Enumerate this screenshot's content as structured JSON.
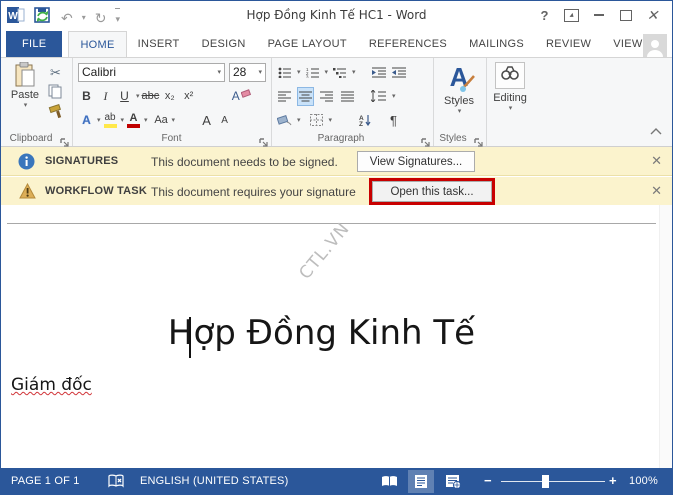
{
  "window": {
    "title": "Hợp Đồng Kinh Tế HC1 - Word",
    "controls": {
      "help": "?"
    }
  },
  "icons": {
    "dropdown": "▾",
    "undo": "↶",
    "redo": "↻",
    "scissors": "✂",
    "close": "✕",
    "info": "i",
    "warning": "!"
  },
  "tabs": {
    "file_label": "FILE",
    "items": [
      "HOME",
      "INSERT",
      "DESIGN",
      "PAGE LAYOUT",
      "REFERENCES",
      "MAILINGS",
      "REVIEW",
      "VIEW"
    ],
    "active": "HOME"
  },
  "ribbon": {
    "clipboard": {
      "paste_label": "Paste",
      "group_label": "Clipboard"
    },
    "font": {
      "family": "Calibri",
      "size": "28",
      "bold": "B",
      "italic": "I",
      "underline": "U",
      "strikethrough": "abc",
      "subscript": "x₂",
      "superscript": "x²",
      "text_effects": "A",
      "highlight": "ab",
      "font_color": "A",
      "change_case": "Aa",
      "grow_font": "A",
      "shrink_font": "A",
      "clear_format": "A",
      "group_label": "Font"
    },
    "paragraph": {
      "pilcrow": "¶",
      "group_label": "Paragraph"
    },
    "styles": {
      "label": "Styles",
      "big_letter": "A",
      "group_label": "Styles"
    },
    "editing": {
      "label": "Editing"
    }
  },
  "message_bars": [
    {
      "category": "SIGNATURES",
      "message": "This document needs to be signed.",
      "button": "View Signatures..."
    },
    {
      "category": "WORKFLOW TASK",
      "message": "This document requires your signature",
      "button": "Open this task..."
    }
  ],
  "document": {
    "watermark": "CTL.VN",
    "heading": "Hợp Đồng Kinh Tế",
    "signature_line": "Giám đốc"
  },
  "status_bar": {
    "page_info": "PAGE 1 OF 1",
    "language": "ENGLISH (UNITED STATES)",
    "zoom_out": "−",
    "zoom_in": "+",
    "zoom_level": "100%"
  },
  "colors": {
    "accent": "#2b579a",
    "message_bar_bg": "#fbf3cd",
    "annotation_red": "#c80000",
    "highlight_yellow": "#ffe84a",
    "font_color_red": "#c00000"
  }
}
